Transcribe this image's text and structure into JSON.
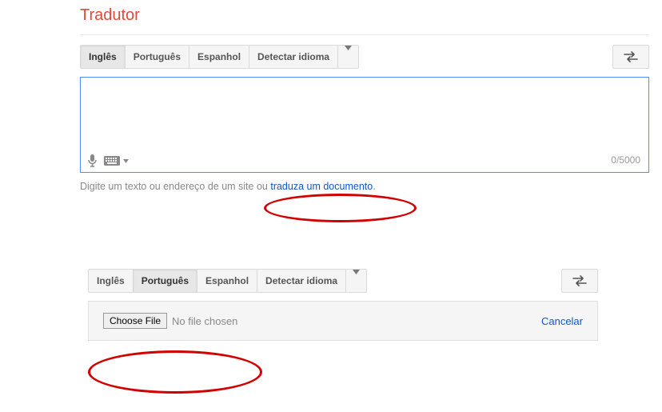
{
  "title": "Tradutor",
  "block1": {
    "tabs": [
      "Inglês",
      "Português",
      "Espanhol",
      "Detectar idioma"
    ],
    "active_index": 0,
    "char_count": "0/5000",
    "hint_prefix": "Digite um texto ou endereço de um site ou ",
    "hint_link": "traduza um documento",
    "hint_suffix": "."
  },
  "block2": {
    "tabs": [
      "Inglês",
      "Português",
      "Espanhol",
      "Detectar idioma"
    ],
    "active_index": 1,
    "choose_label": "Choose File",
    "no_file_label": "No file chosen",
    "cancel_label": "Cancelar"
  }
}
